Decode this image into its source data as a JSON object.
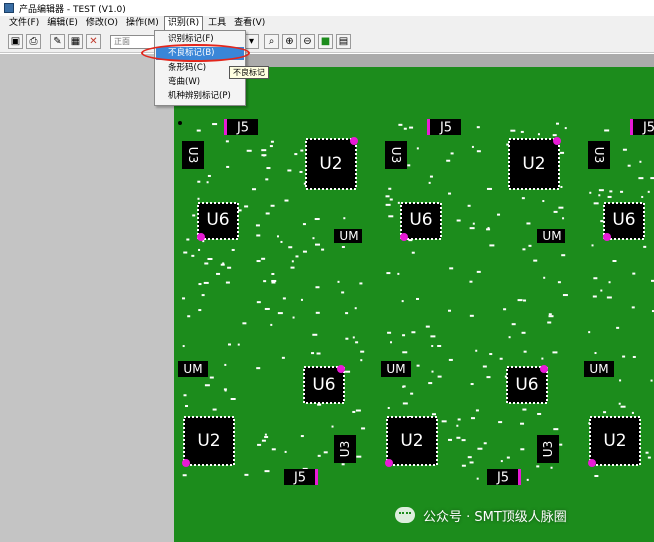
{
  "window": {
    "title": "产品编辑器 - TEST (V1.0)"
  },
  "menubar": {
    "items": [
      "文件(F)",
      "编辑(E)",
      "修改(O)",
      "操作(M)",
      "识别(R)",
      "工具",
      "查看(V)"
    ],
    "active_index": 4
  },
  "toolbar": {
    "face_value": "正面",
    "icons": [
      "save-icon",
      "print-icon",
      "draw-icon",
      "grid-icon",
      "delete-icon",
      "zoom-icon",
      "zoom-in-icon",
      "zoom-out-icon",
      "layer-icon",
      "view-icon"
    ]
  },
  "dropdown": {
    "items": [
      "识别标记(F)",
      "不良标记(B)",
      "条形码(C)",
      "弯曲(W)",
      "机种辨别标记(P)"
    ],
    "highlighted_index": 1
  },
  "tooltip": {
    "text": "不良标记"
  },
  "pcb": {
    "panels": [
      {
        "labels": {
          "j5_top": "J5",
          "u3_top": "U3",
          "u2_top": "U2",
          "u6_top": "U6",
          "um_top": "UM",
          "um_bottom": "UM",
          "u6_bottom": "U6",
          "u2_bottom": "U2",
          "u3_bottom": "U3",
          "j5_bottom": "J5"
        }
      },
      {
        "labels": {
          "j5_top": "J5",
          "u3_top": "U3",
          "u2_top": "U2",
          "u6_top": "U6",
          "um_top": "UM",
          "um_bottom": "UM",
          "u6_bottom": "U6",
          "u2_bottom": "U2",
          "u3_bottom": "U3",
          "j5_bottom": "J5"
        }
      },
      {
        "labels": {
          "j5_top": "J5",
          "u3_top": "U3",
          "u2_top": "U2",
          "u6_top": "U6",
          "um_top": "UM",
          "um_bottom": "UM",
          "u2_bottom": "U2"
        }
      }
    ],
    "colors": {
      "board": "#1c8c1c",
      "chip": "#000000",
      "pin1": "#e81ad6",
      "pad": "#ffffff"
    }
  },
  "watermark": {
    "text": "公众号 · SMT顶级人脉圈"
  }
}
